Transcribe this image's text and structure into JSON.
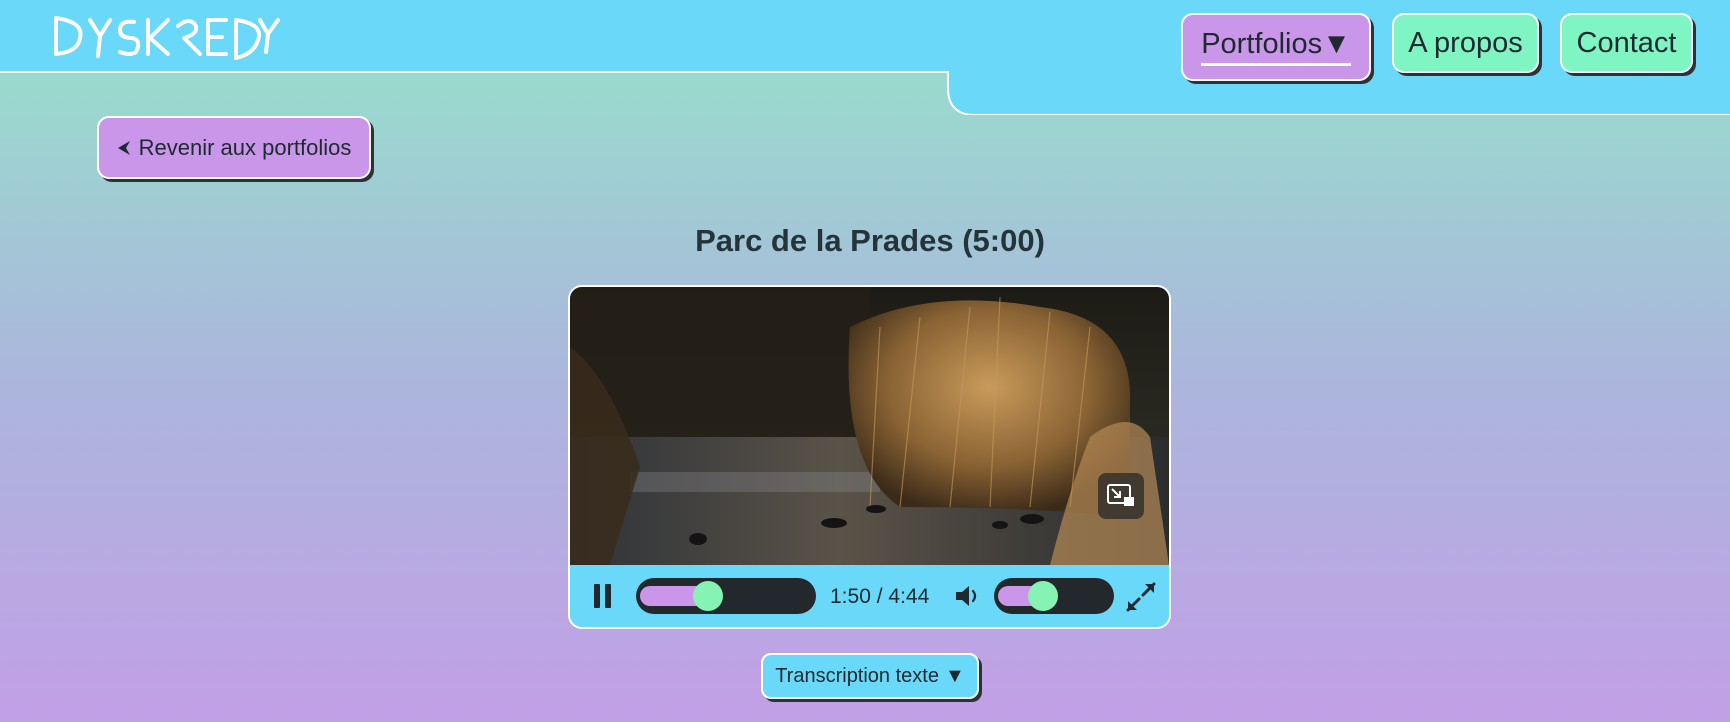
{
  "header": {
    "logo_text": "DYSKREDY",
    "nav": {
      "portfolios_label": "Portfolios",
      "portfolios_arrow": "▼",
      "apropos_label": "A propos",
      "contact_label": "Contact"
    }
  },
  "back_button": {
    "label": "Revenir aux portfolios",
    "icon": "chevron-left-icon"
  },
  "video": {
    "title": "Parc de la Prades (5:00)",
    "current_time": "1:50",
    "duration": "4:44",
    "time_display": "1:50 / 4:44",
    "progress_fraction": 0.39,
    "volume_fraction": 0.42,
    "icons": [
      "pause-icon",
      "volume-icon",
      "fullscreen-icon",
      "picture-in-picture-icon"
    ]
  },
  "transcript": {
    "label": "Transcription texte",
    "arrow": "▼"
  },
  "colors": {
    "header": "#6ad8f8",
    "purple_button": "#c996ea",
    "green_button": "#80f5c4",
    "slider_thumb": "#86f3b5",
    "gradient_top": "#95e3ca",
    "gradient_bottom": "#c29fe6"
  }
}
